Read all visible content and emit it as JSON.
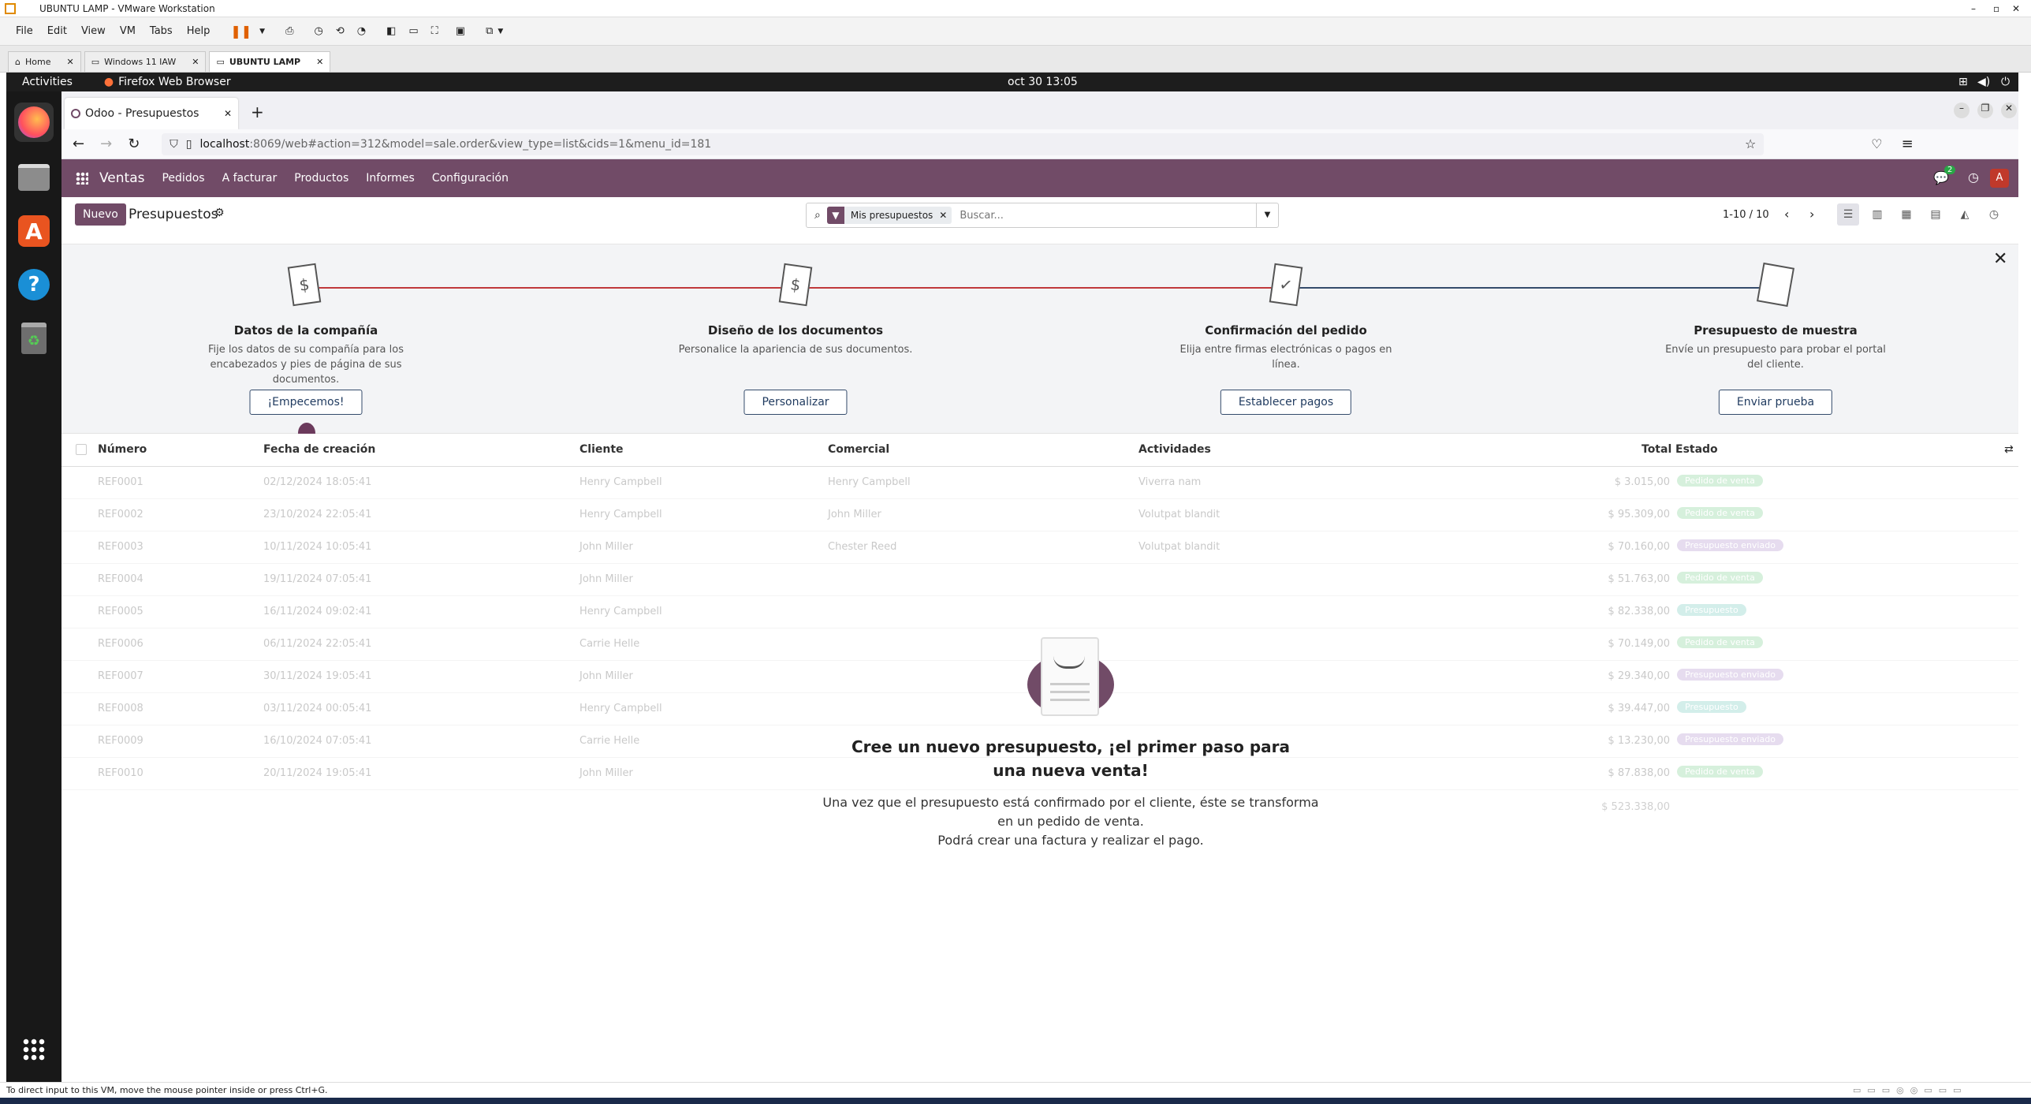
{
  "vm": {
    "title": "UBUNTU LAMP - VMware Workstation",
    "menu": [
      "File",
      "Edit",
      "View",
      "VM",
      "Tabs",
      "Help"
    ],
    "tabs": [
      {
        "label": "Home"
      },
      {
        "label": "Windows 11 IAW"
      },
      {
        "label": "UBUNTU LAMP"
      }
    ],
    "status_hint": "To direct input to this VM, move the mouse pointer inside or press Ctrl+G."
  },
  "gnome": {
    "activities": "Activities",
    "app": "Firefox Web Browser",
    "clock": "oct 30  13:05"
  },
  "firefox": {
    "tab_title": "Odoo - Presupuestos",
    "url_host": "localhost",
    "url_rest": ":8069/web#action=312&model=sale.order&view_type=list&cids=1&menu_id=181"
  },
  "odoo": {
    "app_name": "Ventas",
    "menu": [
      "Pedidos",
      "A facturar",
      "Productos",
      "Informes",
      "Configuración"
    ],
    "chat_count": "2",
    "avatar": "A",
    "new_button": "Nuevo",
    "breadcrumb": "Presupuestos",
    "filter_facet": "Mis presupuestos",
    "search_placeholder": "Buscar...",
    "pager": "1-10 / 10"
  },
  "onboarding": [
    {
      "title": "Datos de la compañía",
      "desc": "Fije los datos de su compañía para los encabezados y pies de página de sus documentos.",
      "button": "¡Empecemos!"
    },
    {
      "title": "Diseño de los documentos",
      "desc": "Personalice la apariencia de sus documentos.",
      "button": "Personalizar"
    },
    {
      "title": "Confirmación del pedido",
      "desc": "Elija entre firmas electrónicas o pagos en línea.",
      "button": "Establecer pagos"
    },
    {
      "title": "Presupuesto de muestra",
      "desc": "Envíe un presupuesto para probar el portal del cliente.",
      "button": "Enviar prueba"
    }
  ],
  "table": {
    "headers": {
      "number": "Número",
      "date": "Fecha de creación",
      "customer": "Cliente",
      "salesperson": "Comercial",
      "activities": "Actividades",
      "total": "Total",
      "state": "Estado"
    },
    "rows": [
      {
        "number": "REF0001",
        "date": "02/12/2024 18:05:41",
        "customer": "Henry Campbell",
        "salesperson": "Henry Campbell",
        "activity": "Viverra nam",
        "total": "$ 3.015,00",
        "state": "Pedido de venta",
        "state_color": "#8fd19e"
      },
      {
        "number": "REF0002",
        "date": "23/10/2024 22:05:41",
        "customer": "Henry Campbell",
        "salesperson": "John Miller",
        "activity": "Volutpat blandit",
        "total": "$ 95.309,00",
        "state": "Pedido de venta",
        "state_color": "#8fd19e"
      },
      {
        "number": "REF0003",
        "date": "10/11/2024 10:05:41",
        "customer": "John Miller",
        "salesperson": "Chester Reed",
        "activity": "Volutpat blandit",
        "total": "$ 70.160,00",
        "state": "Presupuesto enviado",
        "state_color": "#c4a8d8"
      },
      {
        "number": "REF0004",
        "date": "19/11/2024 07:05:41",
        "customer": "John Miller",
        "salesperson": "",
        "activity": "",
        "total": "$ 51.763,00",
        "state": "Pedido de venta",
        "state_color": "#8fd19e"
      },
      {
        "number": "REF0005",
        "date": "16/11/2024 09:02:41",
        "customer": "Henry Campbell",
        "salesperson": "",
        "activity": "",
        "total": "$ 82.338,00",
        "state": "Presupuesto",
        "state_color": "#8fd1c8"
      },
      {
        "number": "REF0006",
        "date": "06/11/2024 22:05:41",
        "customer": "Carrie Helle",
        "salesperson": "",
        "activity": "",
        "total": "$ 70.149,00",
        "state": "Pedido de venta",
        "state_color": "#8fd19e"
      },
      {
        "number": "REF0007",
        "date": "30/11/2024 19:05:41",
        "customer": "John Miller",
        "salesperson": "",
        "activity": "",
        "total": "$ 29.340,00",
        "state": "Presupuesto enviado",
        "state_color": "#c4a8d8"
      },
      {
        "number": "REF0008",
        "date": "03/11/2024 00:05:41",
        "customer": "Henry Campbell",
        "salesperson": "",
        "activity": "",
        "total": "$ 39.447,00",
        "state": "Presupuesto",
        "state_color": "#8fd1c8"
      },
      {
        "number": "REF0009",
        "date": "16/10/2024 07:05:41",
        "customer": "Carrie Helle",
        "salesperson": "",
        "activity": "",
        "total": "$ 13.230,00",
        "state": "Presupuesto enviado",
        "state_color": "#c4a8d8"
      },
      {
        "number": "REF0010",
        "date": "20/11/2024 19:05:41",
        "customer": "John Miller",
        "salesperson": "",
        "activity": "",
        "total": "$ 87.838,00",
        "state": "Pedido de venta",
        "state_color": "#8fd19e"
      }
    ],
    "grand_total": "$ 523.338,00"
  },
  "empty": {
    "title": "Cree un nuevo presupuesto, ¡el primer paso para una nueva venta!",
    "line1": "Una vez que el presupuesto está confirmado por el cliente, éste se transforma en un pedido de venta.",
    "line2": "Podrá crear una factura y realizar el pago."
  },
  "colors": {
    "odoo_purple": "#714b67",
    "button_blue": "#344b6b",
    "progress_red": "#c0393b"
  }
}
